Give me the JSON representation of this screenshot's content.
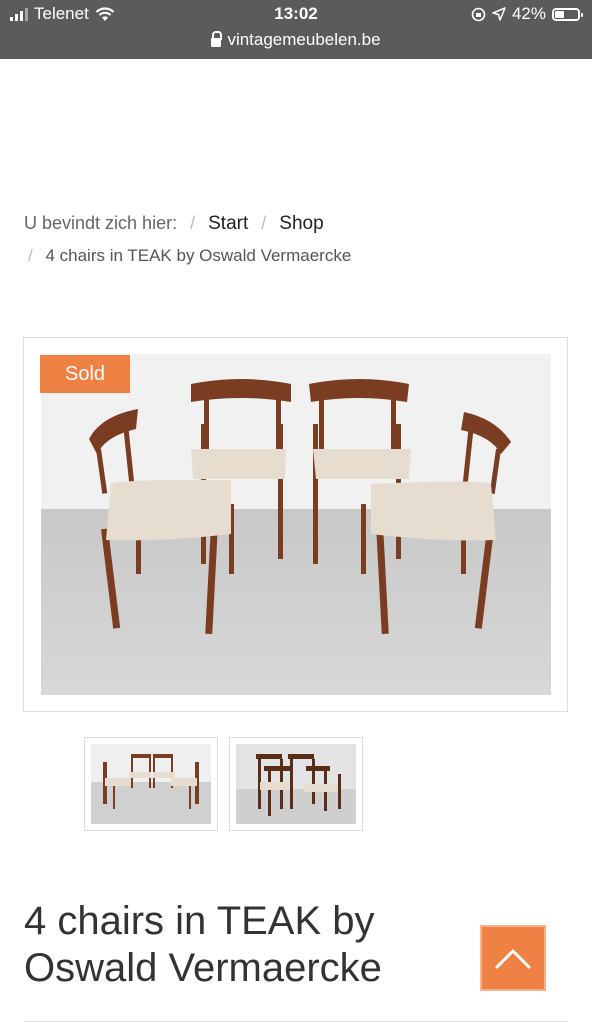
{
  "status_bar": {
    "carrier": "Telenet",
    "time": "13:02",
    "battery": "42%",
    "battery_level": 0.42,
    "url": "vintagemeubelen.be"
  },
  "breadcrumb": {
    "prefix": "U bevindt zich hier:",
    "items": [
      "Start",
      "Shop"
    ],
    "current": "4 chairs in TEAK by Oswald Vermaercke",
    "separator": "/"
  },
  "product": {
    "badge": "Sold",
    "title": "4 chairs in TEAK by Oswald Vermaercke",
    "thumbnail_count": 2
  },
  "colors": {
    "accent": "#f08145",
    "status_bar": "#5b5b5b",
    "teak": "#7a3d22",
    "seat": "#e6ddd0"
  },
  "icons": {
    "lock": "lock-icon",
    "wifi": "wifi-icon",
    "to_top": "chevron-up-icon"
  }
}
